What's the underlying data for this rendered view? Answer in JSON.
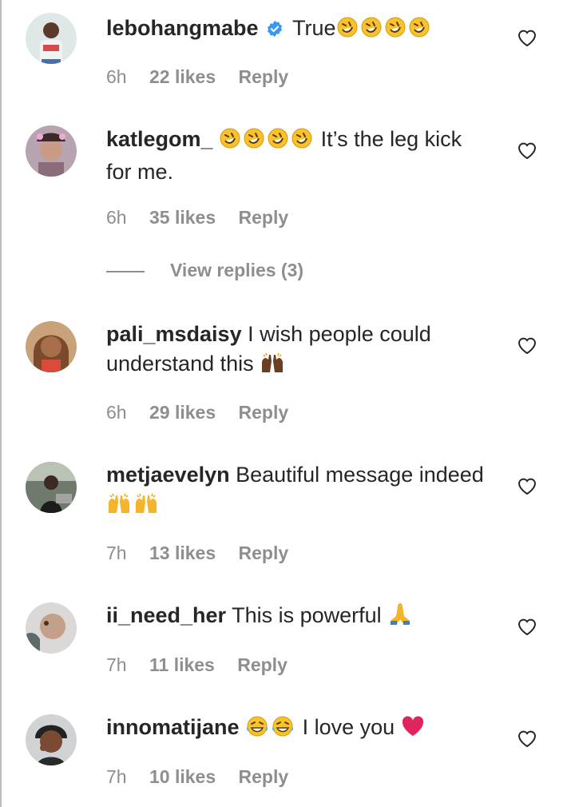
{
  "comments": [
    {
      "username": "lebohangmabe",
      "verified": true,
      "text_before": "",
      "text": "True",
      "emojis": [
        "rofl",
        "rofl",
        "rofl",
        "rofl"
      ],
      "time": "6h",
      "likes": "22 likes",
      "reply": "Reply"
    },
    {
      "username": "katlegom_",
      "verified": false,
      "lead_emojis": [
        "rofl",
        "rofl",
        "rofl",
        "rofl"
      ],
      "text": "It’s the leg kick for me.",
      "time": "6h",
      "likes": "35 likes",
      "reply": "Reply",
      "view_replies": "View replies (3)"
    },
    {
      "username": "pali_msdaisy",
      "verified": false,
      "text": "I wish people could understand this",
      "emojis": [
        "raising-hands-dark"
      ],
      "time": "6h",
      "likes": "29 likes",
      "reply": "Reply"
    },
    {
      "username": "metjaevelyn",
      "verified": false,
      "text": "Beautiful message indeed",
      "emojis": [
        "raising-hands",
        "raising-hands"
      ],
      "time": "7h",
      "likes": "13 likes",
      "reply": "Reply"
    },
    {
      "username": "ii_need_her",
      "verified": false,
      "text": "This is powerful",
      "emojis": [
        "folded-hands"
      ],
      "time": "7h",
      "likes": "11 likes",
      "reply": "Reply"
    },
    {
      "username": "innomatijane",
      "verified": false,
      "lead_emojis": [
        "joy",
        "joy"
      ],
      "text": "I love you",
      "emojis": [
        "red-heart"
      ],
      "time": "7h",
      "likes": "10 likes",
      "reply": "Reply"
    }
  ],
  "colors": {
    "text": "#262626",
    "secondary": "#8e8e8e",
    "verified": "#3897f0",
    "heart_emoji": "#e0245e"
  }
}
